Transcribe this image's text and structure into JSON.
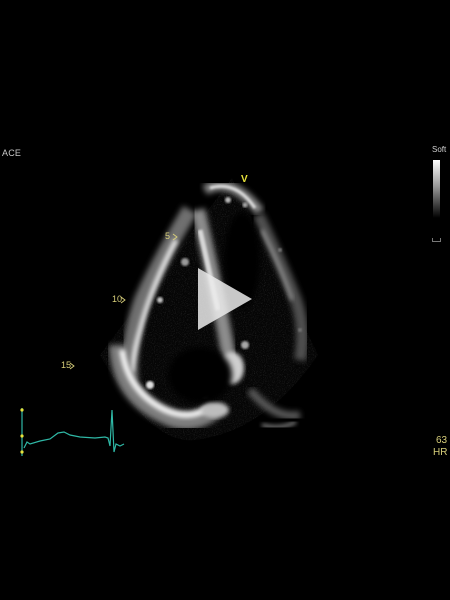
{
  "overlay": {
    "preset_label": "ACE",
    "gray_scale_label": "Soft",
    "view_marker": "V",
    "depth_marks": [
      "5",
      "10",
      "15"
    ],
    "heart_rate_value": "63",
    "heart_rate_label": "HR"
  },
  "colors": {
    "ecg_trace": "#2fb8a6",
    "depth_labels": "#d8cf7a",
    "marker": "#e8e23a"
  },
  "icons": {
    "play": "play-icon"
  }
}
